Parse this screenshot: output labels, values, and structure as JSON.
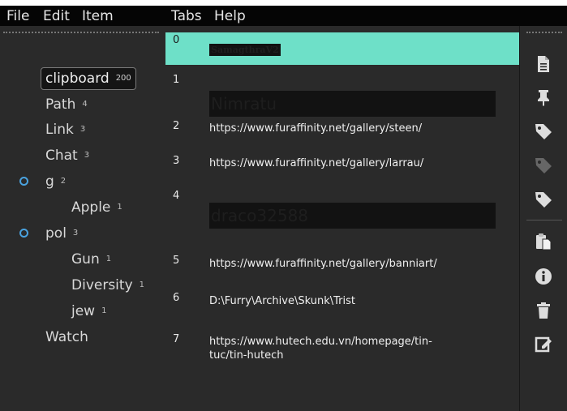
{
  "menu": {
    "file": "File",
    "edit": "Edit",
    "item": "Item",
    "tabs": "Tabs",
    "help": "Help"
  },
  "tree": {
    "items": [
      {
        "label": "clipboard",
        "count": "200",
        "selected": true
      },
      {
        "label": "Path",
        "count": "4"
      },
      {
        "label": "Link",
        "count": "3"
      },
      {
        "label": "Chat",
        "count": "3"
      },
      {
        "label": "g",
        "count": "2",
        "expanded": true
      },
      {
        "label": "Apple",
        "count": "1"
      },
      {
        "label": "pol",
        "count": "3",
        "expanded": true
      },
      {
        "label": "Gun",
        "count": "1"
      },
      {
        "label": "Diversity",
        "count": "1"
      },
      {
        "label": "jew",
        "count": "1"
      },
      {
        "label": "Watch",
        "count": ""
      }
    ]
  },
  "list": {
    "rows": [
      {
        "index": "0",
        "text": "SamagthraV2"
      },
      {
        "index": "1",
        "text": "Nimratu"
      },
      {
        "index": "2",
        "text": "https://www.furaffinity.net/gallery/steen/"
      },
      {
        "index": "3",
        "text": "https://www.furaffinity.net/gallery/larrau/"
      },
      {
        "index": "4",
        "text": "draco32588"
      },
      {
        "index": "5",
        "text": "https://www.furaffinity.net/gallery/banniart/"
      },
      {
        "index": "6",
        "text": "D:\\Furry\\Archive\\Skunk\\Trist"
      },
      {
        "index": "7",
        "text": "https://www.hutech.edu.vn/homepage/tin-",
        "text2": "tuc/tin-hutech"
      }
    ]
  },
  "toolbar": {
    "icons": [
      "new-item-icon",
      "pin-icon",
      "tag-icon",
      "tag-disabled-icon",
      "tag-icon",
      "paste-icon",
      "info-icon",
      "trash-icon",
      "edit-icon"
    ]
  },
  "colors": {
    "selection": "#6ee0c8",
    "expander": "#4aa3e0",
    "panel": "#2a2a2a"
  }
}
